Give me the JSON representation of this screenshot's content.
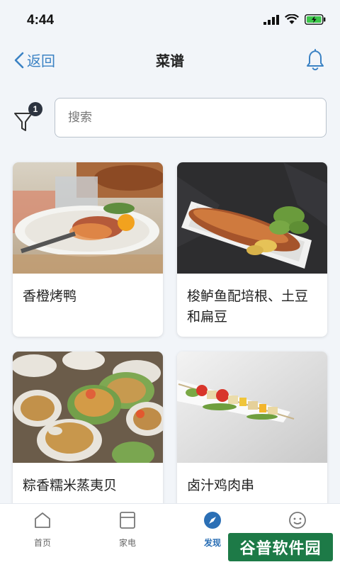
{
  "status_bar": {
    "time": "4:44"
  },
  "nav": {
    "back_label": "返回",
    "title": "菜谱"
  },
  "filter": {
    "badge_count": "1"
  },
  "search": {
    "placeholder": "搜索",
    "value": ""
  },
  "recipes": [
    {
      "name": "香橙烤鸭"
    },
    {
      "name": "梭鲈鱼配培根、土豆和扁豆"
    },
    {
      "name": "粽香糯米蒸夷贝"
    },
    {
      "name": "卤汁鸡肉串"
    }
  ],
  "tabs": [
    {
      "label": "首页",
      "icon": "home-icon",
      "active": false
    },
    {
      "label": "家电",
      "icon": "appliance-icon",
      "active": false
    },
    {
      "label": "发现",
      "icon": "compass-icon",
      "active": true
    },
    {
      "label": "",
      "icon": "smiley-icon",
      "active": false
    }
  ],
  "watermark": {
    "text": "谷普软件园"
  },
  "colors": {
    "accent": "#3b82c4",
    "active_tab": "#2b6fb5",
    "background": "#f2f5f9"
  }
}
